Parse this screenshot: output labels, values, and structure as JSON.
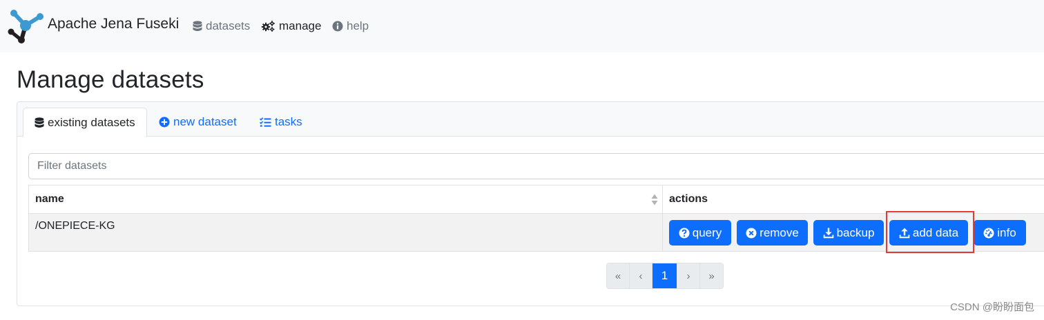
{
  "navbar": {
    "brand": "Apache Jena Fuseki",
    "links": [
      {
        "label": "datasets",
        "icon": "database-icon",
        "active": false
      },
      {
        "label": "manage",
        "icon": "cogs-icon",
        "active": true
      },
      {
        "label": "help",
        "icon": "info-circle-icon",
        "active": false
      }
    ]
  },
  "page": {
    "title": "Manage datasets"
  },
  "tabs": [
    {
      "label": "existing datasets",
      "icon": "database-icon",
      "active": true
    },
    {
      "label": "new dataset",
      "icon": "plus-circle-icon",
      "active": false
    },
    {
      "label": "tasks",
      "icon": "tasks-list-icon",
      "active": false
    }
  ],
  "filter": {
    "placeholder": "Filter datasets",
    "value": ""
  },
  "table": {
    "headers": [
      "name",
      "actions"
    ],
    "rows": [
      {
        "name": "/ONEPIECE-KG",
        "actions": [
          {
            "label": "query",
            "icon": "question-circle-icon"
          },
          {
            "label": "remove",
            "icon": "times-circle-icon"
          },
          {
            "label": "backup",
            "icon": "download-icon"
          },
          {
            "label": "add data",
            "icon": "upload-icon"
          },
          {
            "label": "info",
            "icon": "dashboard-icon"
          }
        ]
      }
    ]
  },
  "pagination": {
    "first": "«",
    "prev": "‹",
    "current": "1",
    "next": "›",
    "last": "»"
  },
  "watermark": "CSDN @盼盼面包",
  "colors": {
    "primary": "#0d6efd",
    "navbar_bg": "#f8f9fa",
    "highlight": "#e53935",
    "logo_blue": "#3d9ad1",
    "logo_dark": "#231f20"
  }
}
